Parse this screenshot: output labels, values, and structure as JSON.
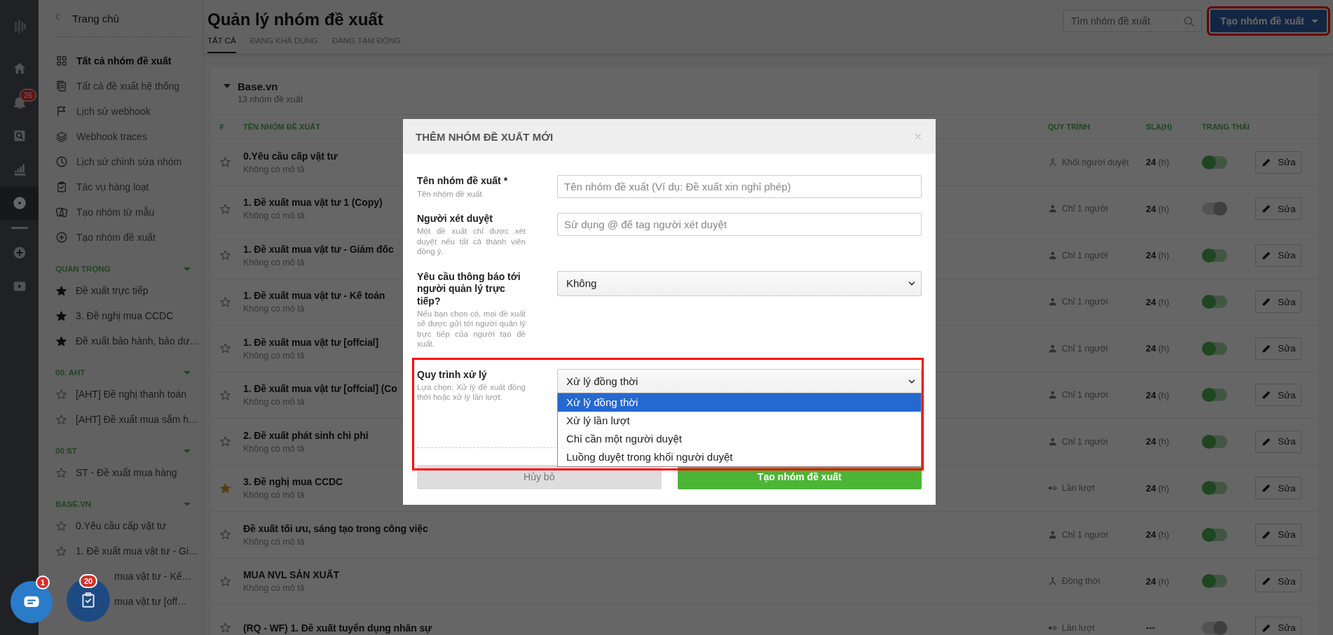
{
  "rail": {
    "notifications_badge": "26",
    "items": [
      {
        "kind": "home",
        "selected": false
      },
      {
        "kind": "bell",
        "selected": false
      },
      {
        "kind": "search",
        "selected": false
      },
      {
        "kind": "chart",
        "selected": false
      },
      {
        "kind": "gear",
        "selected": true
      },
      {
        "kind": "divider",
        "selected": false
      },
      {
        "kind": "plus",
        "selected": false
      },
      {
        "kind": "play",
        "selected": false
      }
    ]
  },
  "sidebar": {
    "back_label": "Trang chủ",
    "menu": [
      {
        "label": "Tất cả nhóm đề xuất",
        "kind": "grid",
        "selected": true
      },
      {
        "label": "Tất cả đề xuất hệ thống",
        "kind": "copy",
        "selected": false
      },
      {
        "label": "Lịch sử webhook",
        "kind": "flag",
        "selected": false
      },
      {
        "label": "Webhook traces",
        "kind": "layers",
        "selected": false
      },
      {
        "label": "Lịch sử chỉnh sửa nhóm",
        "kind": "clock",
        "selected": false
      },
      {
        "label": "Tác vụ hàng loạt",
        "kind": "clipboard",
        "selected": false
      },
      {
        "label": "Tạo nhóm từ mẫu",
        "kind": "cards",
        "selected": false
      },
      {
        "label": "Tạo nhóm đề xuất",
        "kind": "plus",
        "selected": false
      }
    ],
    "sections": [
      {
        "title": "QUAN TRỌNG",
        "items": [
          {
            "label": "Đề xuất trực tiếp",
            "starred": true
          },
          {
            "label": "3. Đề nghị mua CCDC",
            "starred": true
          },
          {
            "label": "Đề xuất bảo hành, bảo dư…",
            "starred": true
          }
        ]
      },
      {
        "title": "00. AHT",
        "items": [
          {
            "label": "[AHT] Đề nghị thanh toán",
            "starred": false
          },
          {
            "label": "[AHT] Đề xuất mua sắm h…",
            "starred": false
          }
        ]
      },
      {
        "title": "00 ST",
        "items": [
          {
            "label": "ST - Đề xuất mua hàng",
            "starred": false
          }
        ]
      },
      {
        "title": "BASE.VN",
        "items": [
          {
            "label": "0.Yêu cầu cấp vật tư",
            "starred": false
          },
          {
            "label": "1. Đề xuất mua vật tư - Gi…",
            "starred": false
          }
        ]
      }
    ],
    "covered_items": [
      "mua vật tư - Kế…",
      "mua vật tư [off…"
    ]
  },
  "header": {
    "title": "Quản lý nhóm đề xuất",
    "tabs": [
      {
        "label": "TẤT CẢ",
        "selected": true
      },
      {
        "label": "ĐANG KHẢ DỤNG",
        "selected": false
      },
      {
        "label": "ĐANG TẠM ĐÓNG",
        "selected": false
      }
    ],
    "search": {
      "placeholder": "Tìm nhóm đề xuất"
    },
    "create_button": "Tạo nhóm đề xuất"
  },
  "group": {
    "name": "Base.vn",
    "count": "13 nhóm đề xuất",
    "columns": [
      "#",
      "TÊN NHÓM ĐỀ XUẤT",
      "QUY TRÌNH",
      "SLA(H)",
      "TRẠNG THÁI"
    ],
    "rows": [
      {
        "name": "0.Yêu cầu cấp vật tư",
        "desc": "Không có mô tả",
        "starred": false,
        "kind": "block",
        "process": "Khối người duyệt",
        "sla": "24",
        "sla_unit": "(h)",
        "on": true,
        "edit": "Sửa"
      },
      {
        "name": "1. Đề xuất mua vật tư 1 (Copy)",
        "desc": "Không có mô tả",
        "starred": false,
        "kind": "single",
        "process": "Chỉ 1 người",
        "sla": "24",
        "sla_unit": "(h)",
        "on": false,
        "edit": "Sửa"
      },
      {
        "name": "1. Đề xuất mua vật tư - Giám đốc",
        "desc": "Không có mô tả",
        "starred": false,
        "kind": "single",
        "process": "Chỉ 1 người",
        "sla": "24",
        "sla_unit": "(h)",
        "on": true,
        "edit": "Sửa"
      },
      {
        "name": "1. Đề xuất mua vật tư - Kế toán",
        "desc": "Không có mô tả",
        "starred": false,
        "kind": "single",
        "process": "Chỉ 1 người",
        "sla": "24",
        "sla_unit": "(h)",
        "on": true,
        "edit": "Sửa"
      },
      {
        "name": "1. Đề xuất mua vật tư [offcial]",
        "desc": "Không có mô tả",
        "starred": false,
        "kind": "single",
        "process": "Chỉ 1 người",
        "sla": "24",
        "sla_unit": "(h)",
        "on": true,
        "edit": "Sửa"
      },
      {
        "name": "1. Đề xuất mua vật tư [offcial] (Co",
        "desc": "Không có mô tả",
        "starred": false,
        "kind": "single",
        "process": "Chỉ 1 người",
        "sla": "24",
        "sla_unit": "(h)",
        "on": true,
        "edit": "Sửa"
      },
      {
        "name": "2. Đề xuất phát sinh chi phí",
        "desc": "Không có mô tả",
        "starred": false,
        "kind": "single",
        "process": "Chỉ 1 người",
        "sla": "24",
        "sla_unit": "(h)",
        "on": true,
        "edit": "Sửa"
      },
      {
        "name": "3. Đề nghị mua CCDC",
        "desc": "Không có mô tả",
        "starred": true,
        "kind": "sequential",
        "process": "Lần lượt",
        "sla": "24",
        "sla_unit": "(h)",
        "on": true,
        "edit": "Sửa"
      },
      {
        "name": "Đề xuất tối ưu, sáng tạo trong công việc",
        "desc": "Không có mô tả",
        "starred": false,
        "kind": "single",
        "process": "Chỉ 1 người",
        "sla": "24",
        "sla_unit": "(h)",
        "on": true,
        "edit": "Sửa"
      },
      {
        "name": "MUA NVL SẢN XUẤT",
        "desc": "Không có mô tả",
        "starred": false,
        "kind": "parallel",
        "process": "Đồng thời",
        "sla": "24",
        "sla_unit": "(h)",
        "on": true,
        "edit": "Sửa"
      },
      {
        "name": "(RQ - WF) 1. Đề xuất tuyển dụng nhân sự",
        "starred": false,
        "kind": "sequential",
        "process": "Lần lượt",
        "sla": "---",
        "on": false,
        "edit": "Sửa"
      }
    ]
  },
  "modal": {
    "title": "THÊM NHÓM ĐỀ XUẤT MỚI",
    "fields": [
      {
        "kind": "text",
        "label": "Tên nhóm đề xuất *",
        "hint": "Tên nhóm đề xuất",
        "placeholder": "Tên nhóm đề xuất (Ví dụ: Đề xuất xin nghỉ phép)"
      },
      {
        "kind": "text",
        "label": "Người xét duyệt",
        "hint": "Một đề xuất chỉ được xét duyệt nếu tất cả thành viên đồng ý.",
        "placeholder": "Sử dụng @ để tag người xét duyệt"
      },
      {
        "kind": "select",
        "label": "Yêu cầu thông báo tới người quản lý trực tiếp?",
        "hint": "Nếu bạn chọn có, mọi đề xuất sẽ được gửi tới người quản lý trực tiếp của người tạo đề xuất.",
        "value": "Không"
      },
      {
        "kind": "open_select",
        "label": "Quy trình xử lý",
        "hint": "Lựa chọn: Xử lý đề xuất đồng thời hoặc xử lý lần lượt.",
        "value": "Xử lý đồng thời",
        "highlighted": true,
        "options": [
          {
            "label": "Xử lý đồng thời",
            "selected": true
          },
          {
            "label": "Xử lý lần lượt",
            "selected": false
          },
          {
            "label": "Chỉ cần một người duyệt",
            "selected": false
          },
          {
            "label": "Luồng duyệt trong khối người duyệt",
            "selected": false
          }
        ]
      }
    ],
    "cancel": "Hủy bỏ",
    "submit": "Tạo nhóm đề xuất"
  },
  "floating": {
    "chat_badge": "1",
    "tasks_badge": "20"
  }
}
